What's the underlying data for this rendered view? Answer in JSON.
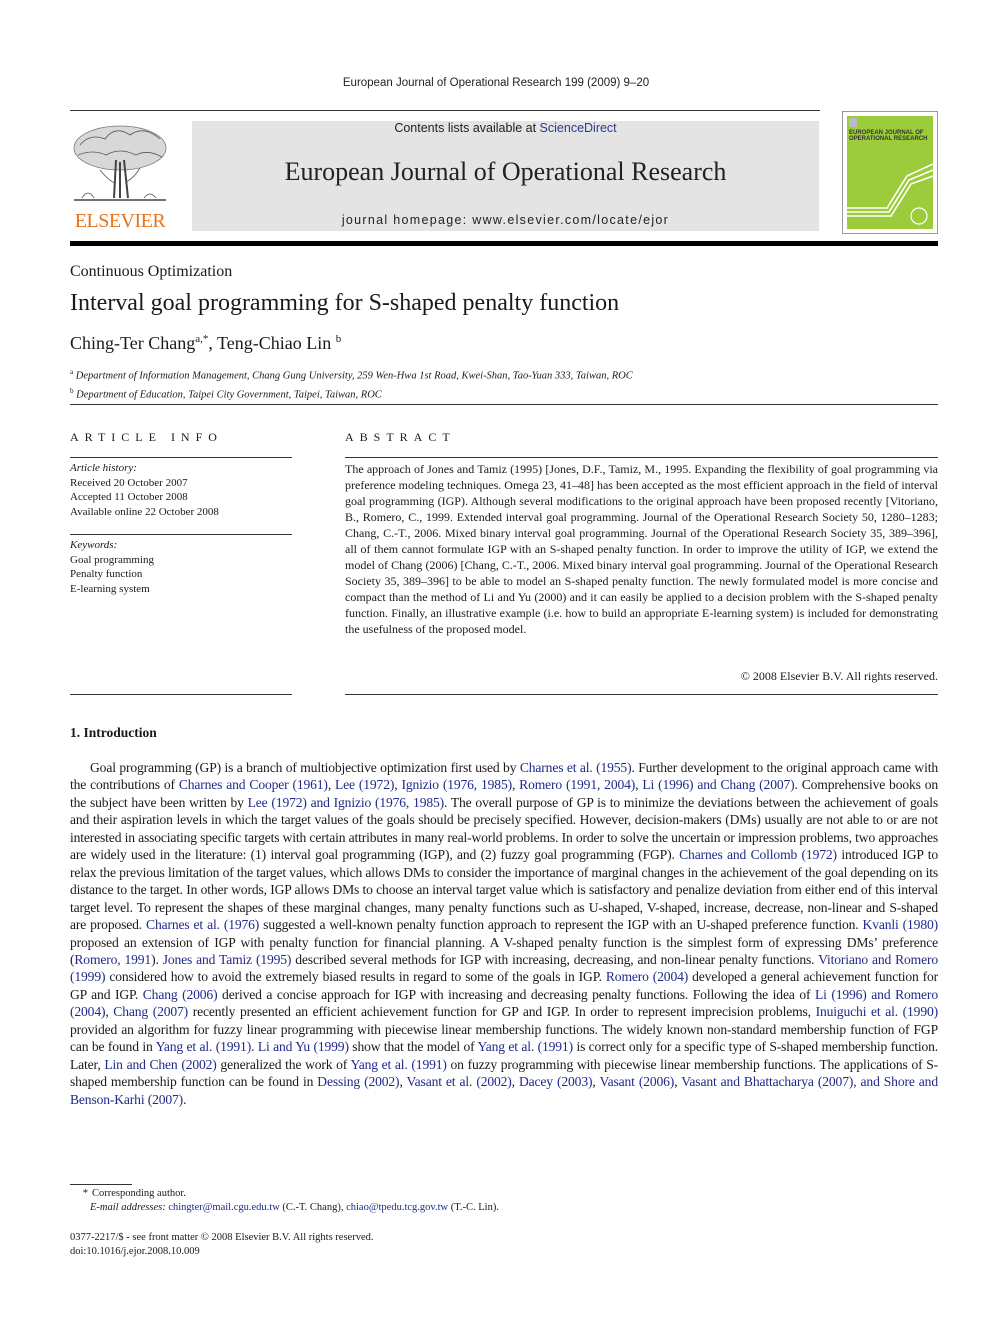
{
  "running_head": "European Journal of Operational Research 199 (2009) 9–20",
  "publisher": {
    "name": "ELSEVIER",
    "logo_icon": "elsevier-tree-logo",
    "brand_color": "#e8731c"
  },
  "banner": {
    "contents_prefix": "Contents lists available at ",
    "contents_link": "ScienceDirect",
    "journal_title": "European Journal of Operational Research",
    "homepage": "journal homepage: www.elsevier.com/locate/ejor",
    "background": "#e4e4e4"
  },
  "cover": {
    "icon": "journal-cover-thumbnail",
    "title_lines": "EUROPEAN JOURNAL OF\nOPERATIONAL RESEARCH",
    "color": "#9ccc3c"
  },
  "article": {
    "section": "Continuous Optimization",
    "title": "Interval goal programming for S-shaped penalty function",
    "authors": [
      {
        "name": "Ching-Ter Chang",
        "sup": "a,*"
      },
      {
        "name": "Teng-Chiao Lin",
        "sup": "b"
      }
    ],
    "author_separator": ", ",
    "affiliations": [
      {
        "sup": "a",
        "text": "Department of Information Management, Chang Gung University, 259 Wen-Hwa 1st Road, Kwei-Shan, Tao-Yuan 333, Taiwan, ROC"
      },
      {
        "sup": "b",
        "text": "Department of Education, Taipei City Government, Taipei, Taiwan, ROC"
      }
    ]
  },
  "article_info": {
    "heading": "ARTICLE INFO",
    "history_label": "Article history:",
    "history": [
      "Received 20 October 2007",
      "Accepted 11 October 2008",
      "Available online 22 October 2008"
    ],
    "keywords_label": "Keywords:",
    "keywords": [
      "Goal programming",
      "Penalty function",
      "E-learning system"
    ]
  },
  "abstract": {
    "heading": "ABSTRACT",
    "text": "The approach of Jones and Tamiz (1995) [Jones, D.F., Tamiz, M., 1995. Expanding the flexibility of goal programming via preference modeling techniques. Omega 23, 41–48] has been accepted as the most effi­cient approach in the field of interval goal programming (IGP). Although several modifications to the ori­ginal approach have been proposed recently [Vitoriano, B., Romero, C., 1999. Extended interval goal programming. Journal of the Operational Research Society 50, 1280–1283; Chang, C.-T., 2006. Mixed bin­ary interval goal programming. Journal of the Operational Research Society 35, 389–396], all of them can­not formulate IGP with an S-shaped penalty function. In order to improve the utility of IGP, we extend the model of Chang (2006) [Chang, C.-T., 2006. Mixed binary interval goal programming. Journal of the Oper­ational Research Society 35, 389–396] to be able to model an S-shaped penalty function. The newly for­mulated model is more concise and compact than the method of Li and Yu (2000) and it can easily be applied to a decision problem with the S-shaped penalty function. Finally, an illustrative example (i.e. how to build an appropriate E-learning system) is included for demonstrating the usefulness of the pro­posed model.",
    "copyright": "© 2008 Elsevier B.V. All rights reserved."
  },
  "introduction": {
    "heading": "1. Introduction",
    "segments": [
      {
        "t": "Goal programming (GP) is a branch of multiobjective optimization first used by "
      },
      {
        "t": "Charnes et al. (1955)",
        "link": true
      },
      {
        "t": ". Further development to the ori­ginal approach came with the contributions of "
      },
      {
        "t": "Charnes and Cooper (1961)",
        "link": true
      },
      {
        "t": ", "
      },
      {
        "t": "Lee (1972)",
        "link": true
      },
      {
        "t": ", "
      },
      {
        "t": "Ignizio (1976, 1985)",
        "link": true
      },
      {
        "t": ", "
      },
      {
        "t": "Romero (1991, 2004)",
        "link": true
      },
      {
        "t": ", "
      },
      {
        "t": "Li (1996) and Chang (2007)",
        "link": true
      },
      {
        "t": ". Comprehensive books on the subject have been written by "
      },
      {
        "t": "Lee (1972) and Ignizio (1976, 1985)",
        "link": true
      },
      {
        "t": ". The overall purpose of GP is to minimize the deviations between the achievement of goals and their aspiration levels in which the target values of the goals should be precisely specified. However, decision-makers (DMs) usually are not able to or are not interested in associating specific targets with certain attributes in many real-world problems. In order to solve the uncertain or impression problems, two approaches are widely used in the literature: (1) interval goal programming (IGP), and (2) fuzzy goal programming (FGP). "
      },
      {
        "t": "Charnes and Collomb (1972)",
        "link": true
      },
      {
        "t": " introduced IGP to relax the previous limitation of the target values, which allows DMs to consider the importance of marginal changes in the achievement of the goal depending on its distance to the target. In other words, IGP allows DMs to choose an interval target value which is satisfactory and penalize deviation from either end of this interval target level. To represent the shapes of these marginal changes, many penalty func­tions such as U-shaped, V-shaped, increase, decrease, non-linear and S-shaped are proposed. "
      },
      {
        "t": "Charnes et al. (1976)",
        "link": true
      },
      {
        "t": " suggested a well-known penalty function approach to represent the IGP with an U-shaped preference function. "
      },
      {
        "t": "Kvanli (1980)",
        "link": true
      },
      {
        "t": " proposed an extension of IGP with penalty function for financial planning. A V-shaped penalty function is the simplest form of expressing DMs’ preference ("
      },
      {
        "t": "Romero, 1991",
        "link": true
      },
      {
        "t": "). "
      },
      {
        "t": "Jones and Tamiz (1995)",
        "link": true
      },
      {
        "t": " described several methods for IGP with increasing, decreasing, and non-linear penalty functions. "
      },
      {
        "t": "Vitoriano and Romero (1999)",
        "link": true
      },
      {
        "t": " considered how to avoid the extremely biased results in regard to some of the goals in IGP. "
      },
      {
        "t": "Romero (2004)",
        "link": true
      },
      {
        "t": " developed a general achievement function for GP and IGP. "
      },
      {
        "t": "Chang (2006)",
        "link": true
      },
      {
        "t": " derived a concise approach for IGP with increasing and decreasing penalty functions. Following the idea of "
      },
      {
        "t": "Li (1996) and Romero (2004)",
        "link": true
      },
      {
        "t": ", "
      },
      {
        "t": "Chang (2007)",
        "link": true
      },
      {
        "t": " recently presented an efficient achievement function for GP and IGP. In order to represent imprecision problems, "
      },
      {
        "t": "Inuiguchi et al. (1990)",
        "link": true
      },
      {
        "t": " provided an algorithm for fuzzy linear programming with piecewise linear membership functions. The widely known non-standard membership function of FGP can be found in "
      },
      {
        "t": "Yang et al. (1991)",
        "link": true
      },
      {
        "t": ". "
      },
      {
        "t": "Li and Yu (1999)",
        "link": true
      },
      {
        "t": " show that the model of "
      },
      {
        "t": "Yang et al. (1991)",
        "link": true
      },
      {
        "t": " is correct only for a specific type of S-shaped membership function. Later, "
      },
      {
        "t": "Lin and Chen (2002)",
        "link": true
      },
      {
        "t": " generalized the work of "
      },
      {
        "t": "Yang et al. (1991)",
        "link": true
      },
      {
        "t": " on fuzzy programming with piecewise linear membership functions. The applications of S-shaped membership function can be found in "
      },
      {
        "t": "Dessing (2002)",
        "link": true
      },
      {
        "t": ", "
      },
      {
        "t": "Vasant et al. (2002)",
        "link": true
      },
      {
        "t": ", "
      },
      {
        "t": "Dacey (2003)",
        "link": true
      },
      {
        "t": ", "
      },
      {
        "t": "Vasant (2006)",
        "link": true
      },
      {
        "t": ", "
      },
      {
        "t": "Va­sant and Bhattacharya (2007), and Shore and Benson-Karhi (2007)",
        "link": true
      },
      {
        "t": "."
      }
    ]
  },
  "footnotes": {
    "star": "*",
    "corresponding": "Corresponding author.",
    "email_label": "E-mail addresses:",
    "emails": [
      {
        "address": "chingter@mail.cgu.edu.tw",
        "who": " (C.-T. Chang), "
      },
      {
        "address": "chiao@tpedu.tcg.gov.tw",
        "who": " (T.-C. Lin)."
      }
    ]
  },
  "imprint": {
    "issn_line": "0377-2217/$ - see front matter © 2008 Elsevier B.V. All rights reserved.",
    "doi": "doi:10.1016/j.ejor.2008.10.009"
  },
  "colors": {
    "link": "#1f2a8a"
  }
}
